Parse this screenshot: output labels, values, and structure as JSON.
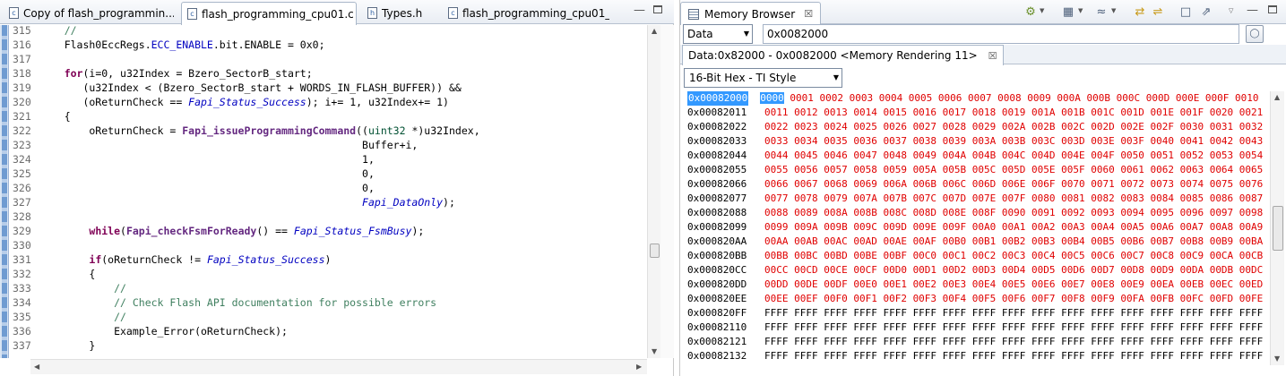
{
  "editor": {
    "tabs": [
      {
        "label": "Copy of flash_programmin...",
        "icon": "c-file-icon",
        "active": false
      },
      {
        "label": "flash_programming_cpu01.c",
        "icon": "c-file-icon",
        "active": true,
        "close": "☒"
      },
      {
        "label": "Types.h",
        "icon": "h-file-icon",
        "active": false
      },
      {
        "label": "flash_programming_cpu01_...",
        "icon": "c-file-icon",
        "active": false
      }
    ],
    "code_lines": [
      {
        "n": "315",
        "t": "    //"
      },
      {
        "n": "316",
        "t": "    Flash0EccRegs.ECC_ENABLE.bit.ENABLE = 0x0;"
      },
      {
        "n": "317",
        "t": ""
      },
      {
        "n": "318",
        "t": "    for(i=0, u32Index = Bzero_SectorB_start;"
      },
      {
        "n": "319",
        "t": "       (u32Index < (Bzero_SectorB_start + WORDS_IN_FLASH_BUFFER)) &&"
      },
      {
        "n": "320",
        "t": "       (oReturnCheck == Fapi_Status_Success); i+= 1, u32Index+= 1)"
      },
      {
        "n": "321",
        "t": "    {"
      },
      {
        "n": "322",
        "t": "        oReturnCheck = Fapi_issueProgrammingCommand((uint32 *)u32Index,"
      },
      {
        "n": "323",
        "t": "                                                    Buffer+i,"
      },
      {
        "n": "324",
        "t": "                                                    1,"
      },
      {
        "n": "325",
        "t": "                                                    0,"
      },
      {
        "n": "326",
        "t": "                                                    0,"
      },
      {
        "n": "327",
        "t": "                                                    Fapi_DataOnly);"
      },
      {
        "n": "328",
        "t": ""
      },
      {
        "n": "329",
        "t": "        while(Fapi_checkFsmForReady() == Fapi_Status_FsmBusy);"
      },
      {
        "n": "330",
        "t": ""
      },
      {
        "n": "331",
        "t": "        if(oReturnCheck != Fapi_Status_Success)"
      },
      {
        "n": "332",
        "t": "        {"
      },
      {
        "n": "333",
        "t": "            //"
      },
      {
        "n": "334",
        "t": "            // Check Flash API documentation for possible errors"
      },
      {
        "n": "335",
        "t": "            //"
      },
      {
        "n": "336",
        "t": "            Example_Error(oReturnCheck);"
      },
      {
        "n": "337",
        "t": "        }"
      }
    ]
  },
  "memory": {
    "tab_label": "Memory Browser",
    "tab_close": "☒",
    "space": "Data",
    "address": "0x0082000",
    "rendering_tab": "Data:0x82000 - 0x0082000 <Memory Rendering 11>",
    "rendering_close": "☒",
    "format": "16-Bit Hex - TI Style",
    "rows": [
      {
        "addr": "0x00082000",
        "first": "0000",
        "vals": " 0001 0002 0003 0004 0005 0006 0007 0008 0009 000A 000B 000C 000D 000E 000F 0010"
      },
      {
        "addr": "0x00082011",
        "vals": "0011 0012 0013 0014 0015 0016 0017 0018 0019 001A 001B 001C 001D 001E 001F 0020 0021"
      },
      {
        "addr": "0x00082022",
        "vals": "0022 0023 0024 0025 0026 0027 0028 0029 002A 002B 002C 002D 002E 002F 0030 0031 0032"
      },
      {
        "addr": "0x00082033",
        "vals": "0033 0034 0035 0036 0037 0038 0039 003A 003B 003C 003D 003E 003F 0040 0041 0042 0043"
      },
      {
        "addr": "0x00082044",
        "vals": "0044 0045 0046 0047 0048 0049 004A 004B 004C 004D 004E 004F 0050 0051 0052 0053 0054"
      },
      {
        "addr": "0x00082055",
        "vals": "0055 0056 0057 0058 0059 005A 005B 005C 005D 005E 005F 0060 0061 0062 0063 0064 0065"
      },
      {
        "addr": "0x00082066",
        "vals": "0066 0067 0068 0069 006A 006B 006C 006D 006E 006F 0070 0071 0072 0073 0074 0075 0076"
      },
      {
        "addr": "0x00082077",
        "vals": "0077 0078 0079 007A 007B 007C 007D 007E 007F 0080 0081 0082 0083 0084 0085 0086 0087"
      },
      {
        "addr": "0x00082088",
        "vals": "0088 0089 008A 008B 008C 008D 008E 008F 0090 0091 0092 0093 0094 0095 0096 0097 0098"
      },
      {
        "addr": "0x00082099",
        "vals": "0099 009A 009B 009C 009D 009E 009F 00A0 00A1 00A2 00A3 00A4 00A5 00A6 00A7 00A8 00A9"
      },
      {
        "addr": "0x000820AA",
        "vals": "00AA 00AB 00AC 00AD 00AE 00AF 00B0 00B1 00B2 00B3 00B4 00B5 00B6 00B7 00B8 00B9 00BA"
      },
      {
        "addr": "0x000820BB",
        "vals": "00BB 00BC 00BD 00BE 00BF 00C0 00C1 00C2 00C3 00C4 00C5 00C6 00C7 00C8 00C9 00CA 00CB"
      },
      {
        "addr": "0x000820CC",
        "vals": "00CC 00CD 00CE 00CF 00D0 00D1 00D2 00D3 00D4 00D5 00D6 00D7 00D8 00D9 00DA 00DB 00DC"
      },
      {
        "addr": "0x000820DD",
        "vals": "00DD 00DE 00DF 00E0 00E1 00E2 00E3 00E4 00E5 00E6 00E7 00E8 00E9 00EA 00EB 00EC 00ED"
      },
      {
        "addr": "0x000820EE",
        "vals": "00EE 00EF 00F0 00F1 00F2 00F3 00F4 00F5 00F6 00F7 00F8 00F9 00FA 00FB 00FC 00FD 00FE"
      },
      {
        "addr": "0x000820FF",
        "vals": "FFFF FFFF FFFF FFFF FFFF FFFF FFFF FFFF FFFF FFFF FFFF FFFF FFFF FFFF FFFF FFFF FFFF"
      },
      {
        "addr": "0x00082110",
        "vals": "FFFF FFFF FFFF FFFF FFFF FFFF FFFF FFFF FFFF FFFF FFFF FFFF FFFF FFFF FFFF FFFF FFFF"
      },
      {
        "addr": "0x00082121",
        "vals": "FFFF FFFF FFFF FFFF FFFF FFFF FFFF FFFF FFFF FFFF FFFF FFFF FFFF FFFF FFFF FFFF FFFF"
      },
      {
        "addr": "0x00082132",
        "vals": "FFFF FFFF FFFF FFFF FFFF FFFF FFFF FFFF FFFF FFFF FFFF FFFF FFFF FFFF FFFF FFFF FFFF"
      }
    ]
  },
  "colors": {
    "accent": "#3399ff",
    "value_text": "#e00000",
    "keyword": "#7f0055",
    "comment": "#3f7f5f"
  }
}
